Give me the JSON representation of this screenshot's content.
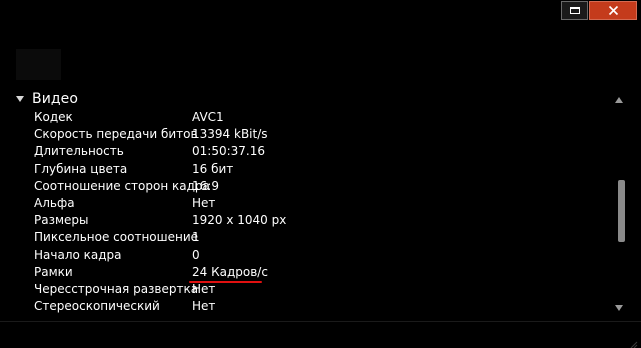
{
  "window": {
    "maximize_icon": "maximize-icon",
    "close_icon": "close-icon",
    "close_color": "#c43b1c"
  },
  "section": {
    "title": "Видео",
    "expanded": true,
    "caret_icon": "triangle-down-icon"
  },
  "properties": [
    {
      "key": "Кодек",
      "value": "AVC1"
    },
    {
      "key": "Скорость передачи битов",
      "value": "13394 kBit/s"
    },
    {
      "key": "Длительность",
      "value": "01:50:37.16"
    },
    {
      "key": "Глубина цвета",
      "value": "16 бит"
    },
    {
      "key": "Соотношение сторон кадра",
      "value": "16:9"
    },
    {
      "key": "Альфа",
      "value": "Нет"
    },
    {
      "key": "Размеры",
      "value": "1920 x 1040 px"
    },
    {
      "key": "Пиксельное соотношение",
      "value": "1"
    },
    {
      "key": "Начало кадра",
      "value": "0"
    },
    {
      "key": "Рамки",
      "value": "24 Кадров/с",
      "highlighted": true
    },
    {
      "key": "Чересстрочная развертка",
      "value": "Нет"
    },
    {
      "key": "Стереоскопический",
      "value": "Нет"
    }
  ],
  "highlight_color": "#e01010",
  "scrollbar": {
    "up_icon": "scroll-up-arrow-icon",
    "down_icon": "scroll-down-arrow-icon"
  }
}
